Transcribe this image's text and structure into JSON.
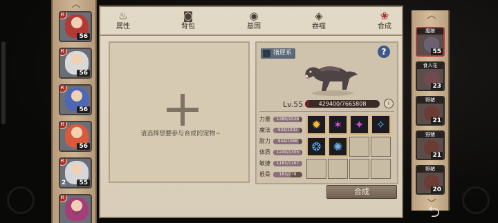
{
  "tabs": [
    {
      "label": "属性",
      "icon": "flame-icon",
      "active": false
    },
    {
      "label": "背包",
      "icon": "backpack-icon",
      "active": false
    },
    {
      "label": "基因",
      "icon": "gene-icon",
      "active": false
    },
    {
      "label": "吞噬",
      "icon": "devour-icon",
      "active": false
    },
    {
      "label": "合成",
      "icon": "merge-icon",
      "active": true
    }
  ],
  "heroes": [
    {
      "level": "56",
      "badge": "R",
      "color": "#b33a34"
    },
    {
      "level": "56",
      "badge": "R",
      "color": "#d9d9d9"
    },
    {
      "level": "56",
      "badge": "R",
      "color": "#4c67b5"
    },
    {
      "level": "56",
      "badge": "R",
      "color": "#d95a3b"
    },
    {
      "level": "55",
      "badge": "R",
      "count": "2",
      "color": "#d5d7dd"
    },
    {
      "level": "",
      "badge": "R",
      "color": "#a43e78"
    }
  ],
  "left_box": {
    "hint": "请选择想要参与合成的宠物~"
  },
  "pet_detail": {
    "tag": "猎犀系",
    "help": "?",
    "level_label": "Lv.55",
    "xp_text": "429400/7665808",
    "xp_fraction": 0.056,
    "info": "i",
    "stats": [
      {
        "label": "力量",
        "value": "1389/1526",
        "fraction": 0.91
      },
      {
        "label": "魔法",
        "value": "934/1042",
        "fraction": 0.9
      },
      {
        "label": "耐力",
        "value": "944/1068",
        "fraction": 0.88
      },
      {
        "label": "体质",
        "value": "1249/1305",
        "fraction": 0.96
      },
      {
        "label": "敏捷",
        "value": "1165/1167",
        "fraction": 0.99
      },
      {
        "label": "根骨",
        "value": "163/278",
        "fraction": 0.59
      }
    ],
    "skills": [
      {
        "filled": true,
        "glyph": "✹",
        "color": "#f0b73b",
        "icon": "sun-skill-icon"
      },
      {
        "filled": true,
        "glyph": "✶",
        "color": "#d64ed9",
        "icon": "claw-skill-icon"
      },
      {
        "filled": true,
        "glyph": "✦",
        "color": "#c94fd7",
        "icon": "burst-skill-icon"
      },
      {
        "filled": true,
        "glyph": "✧",
        "color": "#5fb3e8",
        "icon": "ice-skill-icon"
      },
      {
        "filled": true,
        "glyph": "❂",
        "color": "#5ba7e6",
        "icon": "swirl-skill-icon"
      },
      {
        "filled": true,
        "glyph": "✺",
        "color": "#6fb1e6",
        "icon": "ring-skill-icon"
      },
      {
        "filled": false
      },
      {
        "filled": false
      },
      {
        "filled": false
      },
      {
        "filled": false
      },
      {
        "filled": false
      },
      {
        "filled": false
      }
    ]
  },
  "combine_button": "合成",
  "pets": [
    {
      "name": "魔狼",
      "level": "55",
      "selected": true,
      "color": "#6e6073"
    },
    {
      "name": "食人花",
      "level": "23",
      "selected": false,
      "color": "#704a4f"
    },
    {
      "name": "野猪",
      "level": "21",
      "selected": false,
      "color": "#6b3c33"
    },
    {
      "name": "野猪",
      "level": "21",
      "selected": false,
      "color": "#6b3c33"
    },
    {
      "name": "野猪",
      "level": "20",
      "selected": false,
      "color": "#6b3c33"
    }
  ]
}
